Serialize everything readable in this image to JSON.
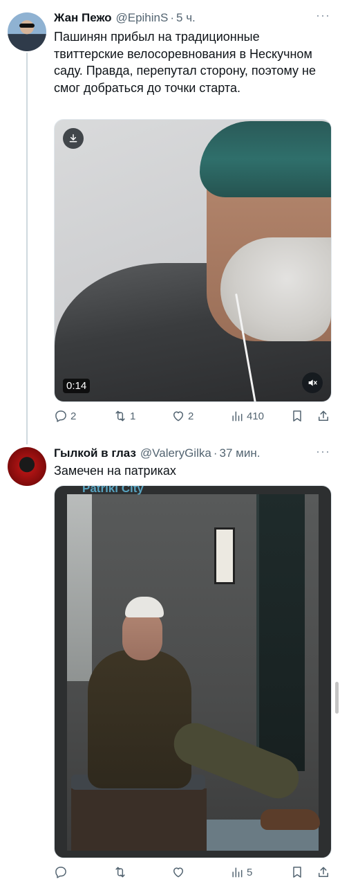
{
  "tweets": [
    {
      "author_name": "Жан Пежо",
      "handle": "@EpihinS",
      "separator": "·",
      "time": "5 ч.",
      "more": "···",
      "text": "Пашинян прибыл на традиционные твиттерские велосоревнования в Нескучном саду. Правда, перепутал сторону, поэтому не смог добраться до точки старта.",
      "media": {
        "type": "video",
        "duration": "0:14"
      },
      "actions": {
        "replies": "2",
        "retweets": "1",
        "likes": "2",
        "views": "410"
      }
    },
    {
      "author_name": "Гылкой в глаз",
      "handle": "@ValeryGilka",
      "separator": "·",
      "time": "37 мин.",
      "more": "···",
      "text": "Замечен на патриках",
      "media": {
        "type": "photo",
        "caption": "Patriki City"
      },
      "actions": {
        "replies": "",
        "retweets": "",
        "likes": "",
        "views": "5"
      }
    }
  ],
  "colors": {
    "text": "#0f1419",
    "secondary": "#536471",
    "thread_line": "#cfd9de"
  },
  "icons": [
    "reply-icon",
    "retweet-icon",
    "like-icon",
    "views-icon",
    "bookmark-icon",
    "share-icon",
    "download-icon",
    "mute-icon",
    "more-icon"
  ]
}
